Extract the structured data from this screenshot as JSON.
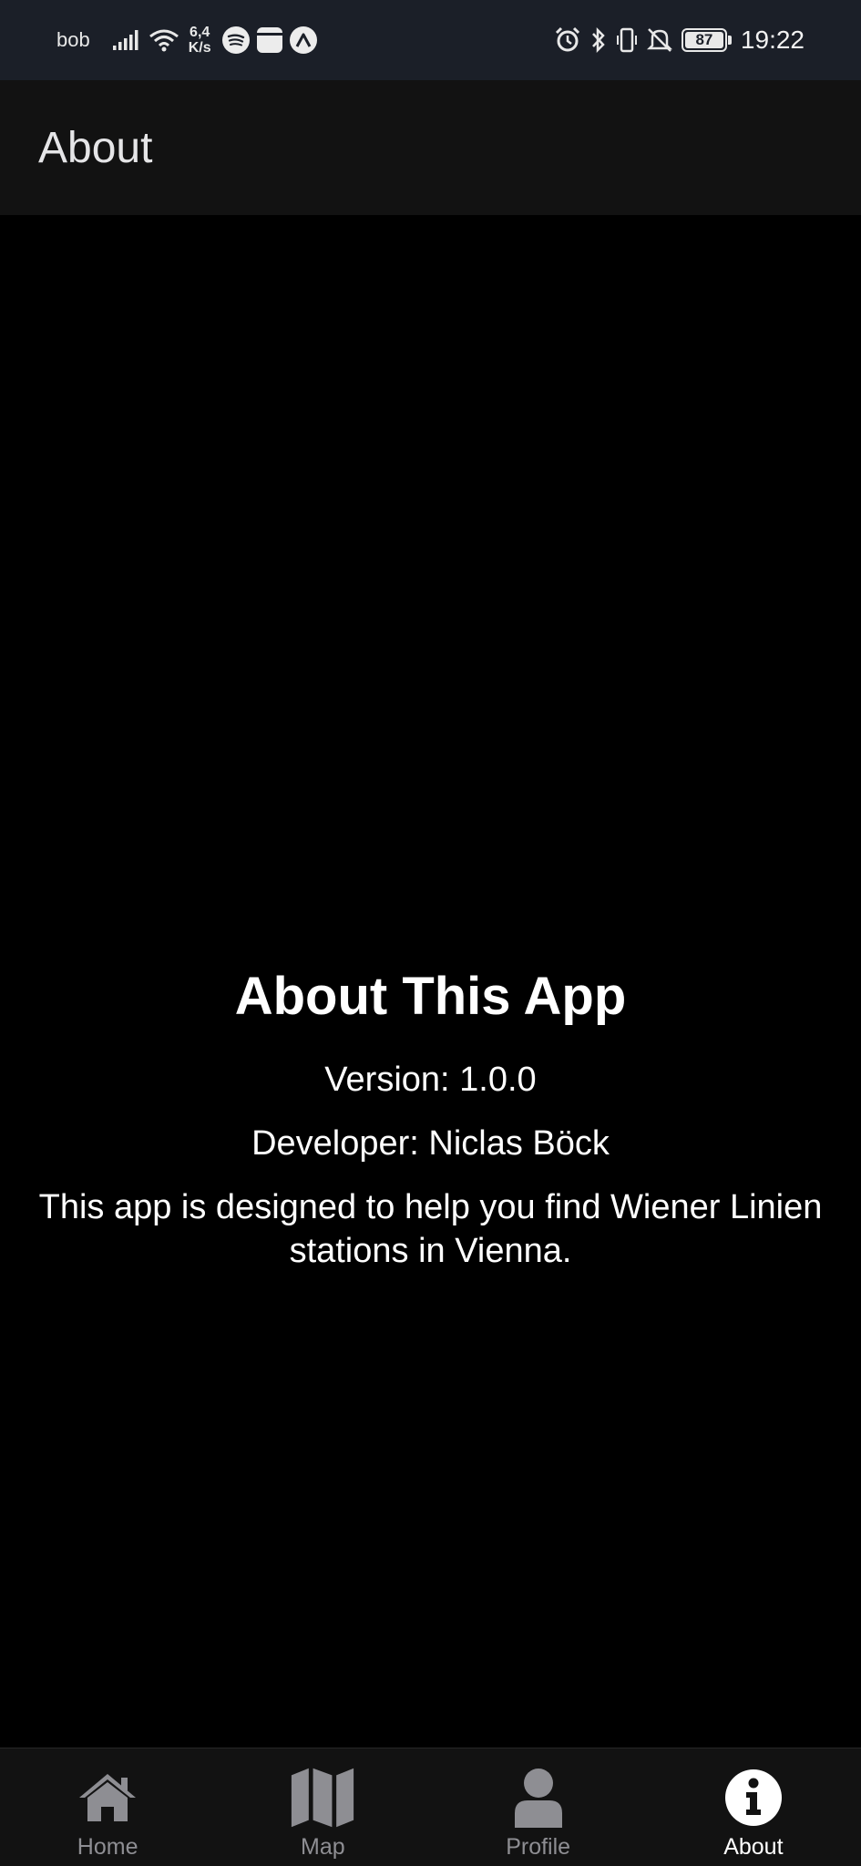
{
  "status_bar": {
    "carrier": "bob",
    "net_speed_value": "6,4",
    "net_speed_unit": "K/s",
    "battery_level": "87",
    "time": "19:22",
    "icons": [
      "signal-icon",
      "wifi-icon",
      "spotify-icon",
      "calendar-icon",
      "app-icon",
      "alarm-icon",
      "bluetooth-icon",
      "vibrate-icon",
      "mute-icon",
      "battery-icon"
    ]
  },
  "header": {
    "title": "About"
  },
  "about": {
    "heading": "About This App",
    "version": "Version: 1.0.0",
    "developer": "Developer: Niclas Böck",
    "description": "This app is designed to help you find Wiener Linien stations in Vienna."
  },
  "tabs": [
    {
      "label": "Home",
      "icon": "home-icon",
      "active": false
    },
    {
      "label": "Map",
      "icon": "map-icon",
      "active": false
    },
    {
      "label": "Profile",
      "icon": "profile-icon",
      "active": false
    },
    {
      "label": "About",
      "icon": "info-icon",
      "active": true
    }
  ],
  "colors": {
    "status_bar_bg": "#1b1f28",
    "header_bg": "#121212",
    "content_bg": "#000000",
    "tab_inactive": "#8e8e93",
    "tab_active": "#ffffff"
  }
}
